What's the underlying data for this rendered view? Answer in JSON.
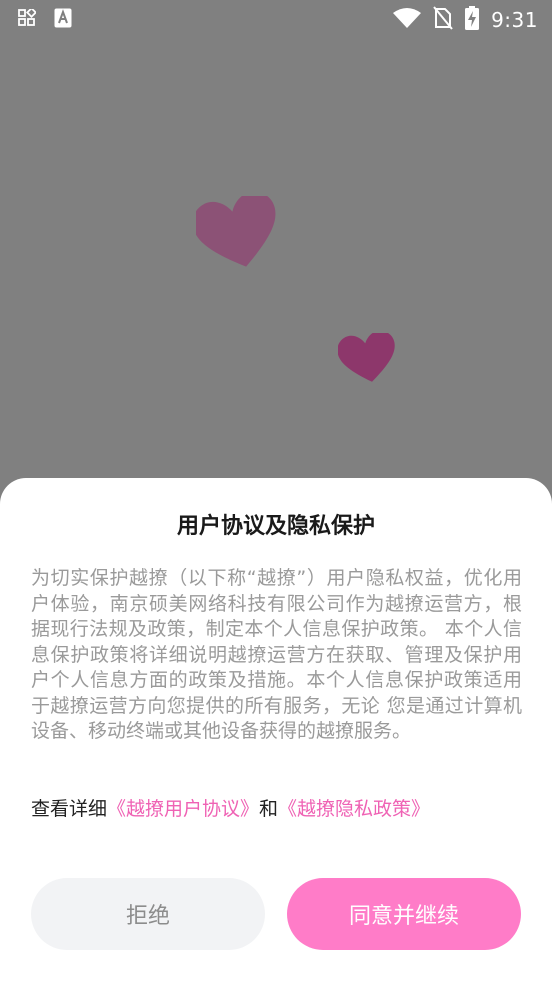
{
  "status_bar": {
    "time": "9:31",
    "left_icons": [
      "apps-grid-icon",
      "font-a-icon"
    ],
    "right_icons": [
      "wifi-icon",
      "no-sim-icon",
      "battery-charging-icon"
    ]
  },
  "background": {
    "overlay_color": "#808080",
    "heart_color": "#8e4a74"
  },
  "dialog": {
    "title": "用户协议及隐私保护",
    "body": "为切实保护越撩（以下称“越撩”）用户隐私权益，优化用户体验，南京硕美网络科技有限公司作为越撩运营方，根据现行法规及政策，制定本个人信息保护政策。 本个人信息保护政策将详细说明越撩运营方在获取、管理及保护用户个人信息方面的政策及措施。本个人信息保护政策适用于越撩运营方向您提供的所有服务，无论 您是通过计算机设备、移动终端或其他设备获得的越撩服务。",
    "links_prefix": "查看详细",
    "user_agreement_link": "《越撩用户协议》",
    "links_joiner": "和",
    "privacy_policy_link": "《越撩隐私政策》",
    "reject_label": "拒绝",
    "agree_label": "同意并继续",
    "link_color": "#ef62b4",
    "agree_button_color": "#ff7cc8"
  }
}
